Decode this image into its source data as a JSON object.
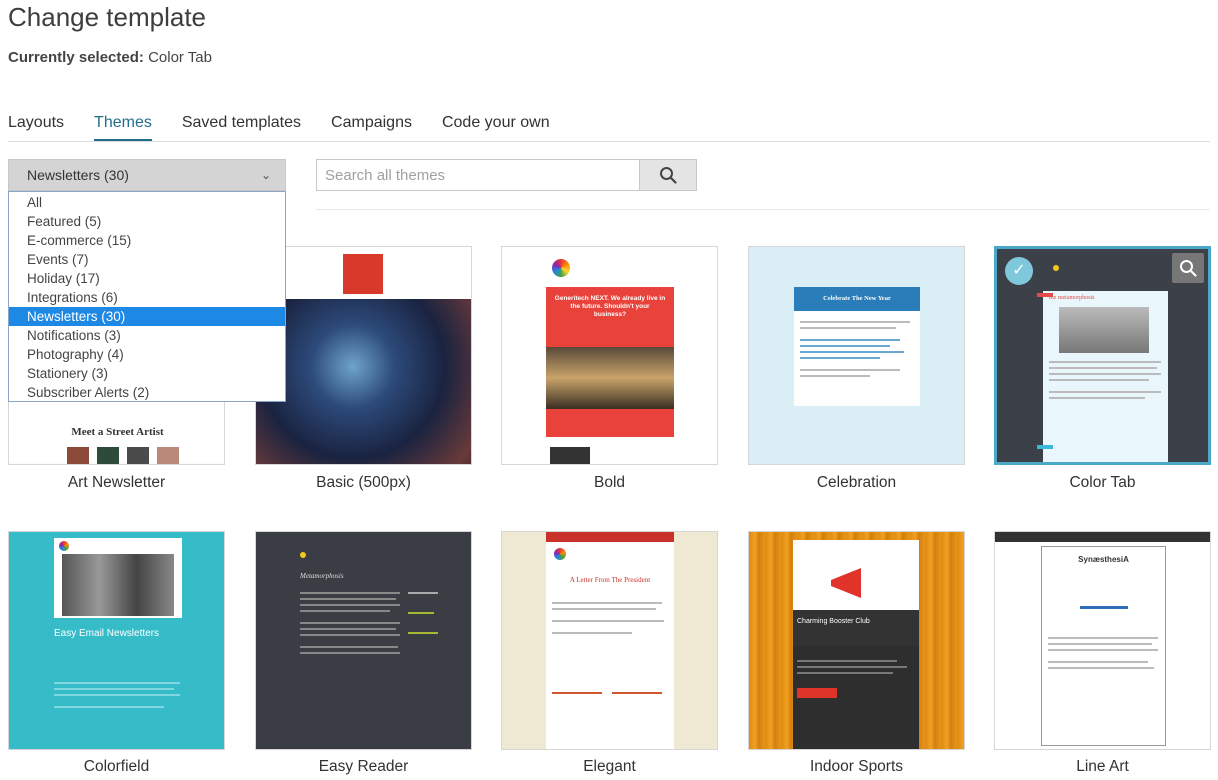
{
  "header": {
    "title": "Change template",
    "current_label": "Currently selected:",
    "current_value": "Color Tab"
  },
  "tabs": [
    {
      "label": "Layouts",
      "active": false
    },
    {
      "label": "Themes",
      "active": true
    },
    {
      "label": "Saved templates",
      "active": false
    },
    {
      "label": "Campaigns",
      "active": false
    },
    {
      "label": "Code your own",
      "active": false
    }
  ],
  "category_select": {
    "value": "Newsletters (30)",
    "icon": "chevron-down-icon",
    "options": [
      "All",
      "Featured (5)",
      "E-commerce (15)",
      "Events (7)",
      "Holiday (17)",
      "Integrations (6)",
      "Newsletters (30)",
      "Notifications (3)",
      "Photography (4)",
      "Stationery (3)",
      "Subscriber Alerts (2)"
    ],
    "selected_index": 6
  },
  "search": {
    "placeholder": "Search all themes",
    "button_icon": "search-icon"
  },
  "templates": [
    {
      "name": "Art Newsletter",
      "preview_text": "Meet a Street Artist"
    },
    {
      "name": "Basic (500px)"
    },
    {
      "name": "Bold",
      "preview_text": "Generitech NEXT. We already live in the future. Shouldn't your business?"
    },
    {
      "name": "Celebration",
      "preview_text": "Celebrate The New Year"
    },
    {
      "name": "Color Tab",
      "selected": true,
      "preview_text": "the metamorphosis"
    },
    {
      "name": "Colorfield",
      "preview_text": "Easy Email Newsletters"
    },
    {
      "name": "Easy Reader",
      "preview_text": "Metamorphosis"
    },
    {
      "name": "Elegant",
      "preview_text": "A Letter From The President"
    },
    {
      "name": "Indoor Sports",
      "preview_text": "Charming Booster Club"
    },
    {
      "name": "Line Art",
      "preview_text": "SynæsthesiA"
    }
  ],
  "colors": {
    "accent": "#1f6f8b",
    "dropdown_selected": "#1e88e5",
    "selected_border": "#4aa9c8"
  }
}
